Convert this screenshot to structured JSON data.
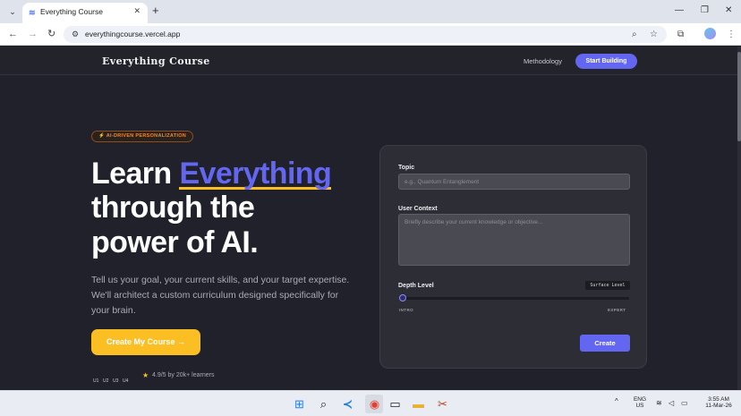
{
  "browser": {
    "tab_title": "Everything Course",
    "url": "everythingcourse.vercel.app",
    "icons": [
      "tab-list-icon",
      "favicon-icon",
      "close-icon",
      "new-tab-icon",
      "minimize-icon",
      "restore-icon",
      "close-window-icon",
      "back-icon",
      "forward-icon",
      "reload-icon",
      "site-info-icon",
      "zoom-icon",
      "bookmark-star-icon",
      "extensions-icon",
      "profile-avatar",
      "menu-icon"
    ]
  },
  "site": {
    "brand": "Everything Course",
    "nav_link": "Methodology",
    "nav_button": "Start Building"
  },
  "hero": {
    "badge": "⚡ AI-DRIVEN PERSONALIZATION",
    "title_line1_pre": "Learn ",
    "title_line1_accent": "Everything",
    "title_line2": "through the",
    "title_line3": "power of AI.",
    "lead": "Tell us your goal, your current skills, and your target expertise. We'll architect a custom curriculum designed specifically for your brain.",
    "cta": "Create My Course →",
    "avatars": [
      "U1",
      "U2",
      "U3",
      "U4"
    ],
    "rating": "4.9/5 by 20k+ learners"
  },
  "form": {
    "topic_label": "Topic",
    "topic_placeholder": "e.g., Quantum Entanglement",
    "context_label": "User Context",
    "context_placeholder": "Briefly describe your current knowledge or objective...",
    "depth_label": "Depth Level",
    "depth_value": "Surface Level",
    "depth_level": 0,
    "min_label": "INTRO",
    "max_label": "EXPERT",
    "submit": "Create"
  },
  "taskbar": {
    "apps": [
      "windows-start-icon",
      "search-icon",
      "vscode-icon",
      "chrome-icon",
      "terminal-icon",
      "file-explorer-icon",
      "snipping-tool-icon"
    ],
    "lang_line1": "ENG",
    "lang_line2": "US",
    "time": "3:55 AM",
    "date": "11-Mar-26"
  },
  "colors": {
    "accent": "#6366f1",
    "highlight": "#fbbf24",
    "badge": "#f08a2c",
    "background": "#20212a"
  }
}
